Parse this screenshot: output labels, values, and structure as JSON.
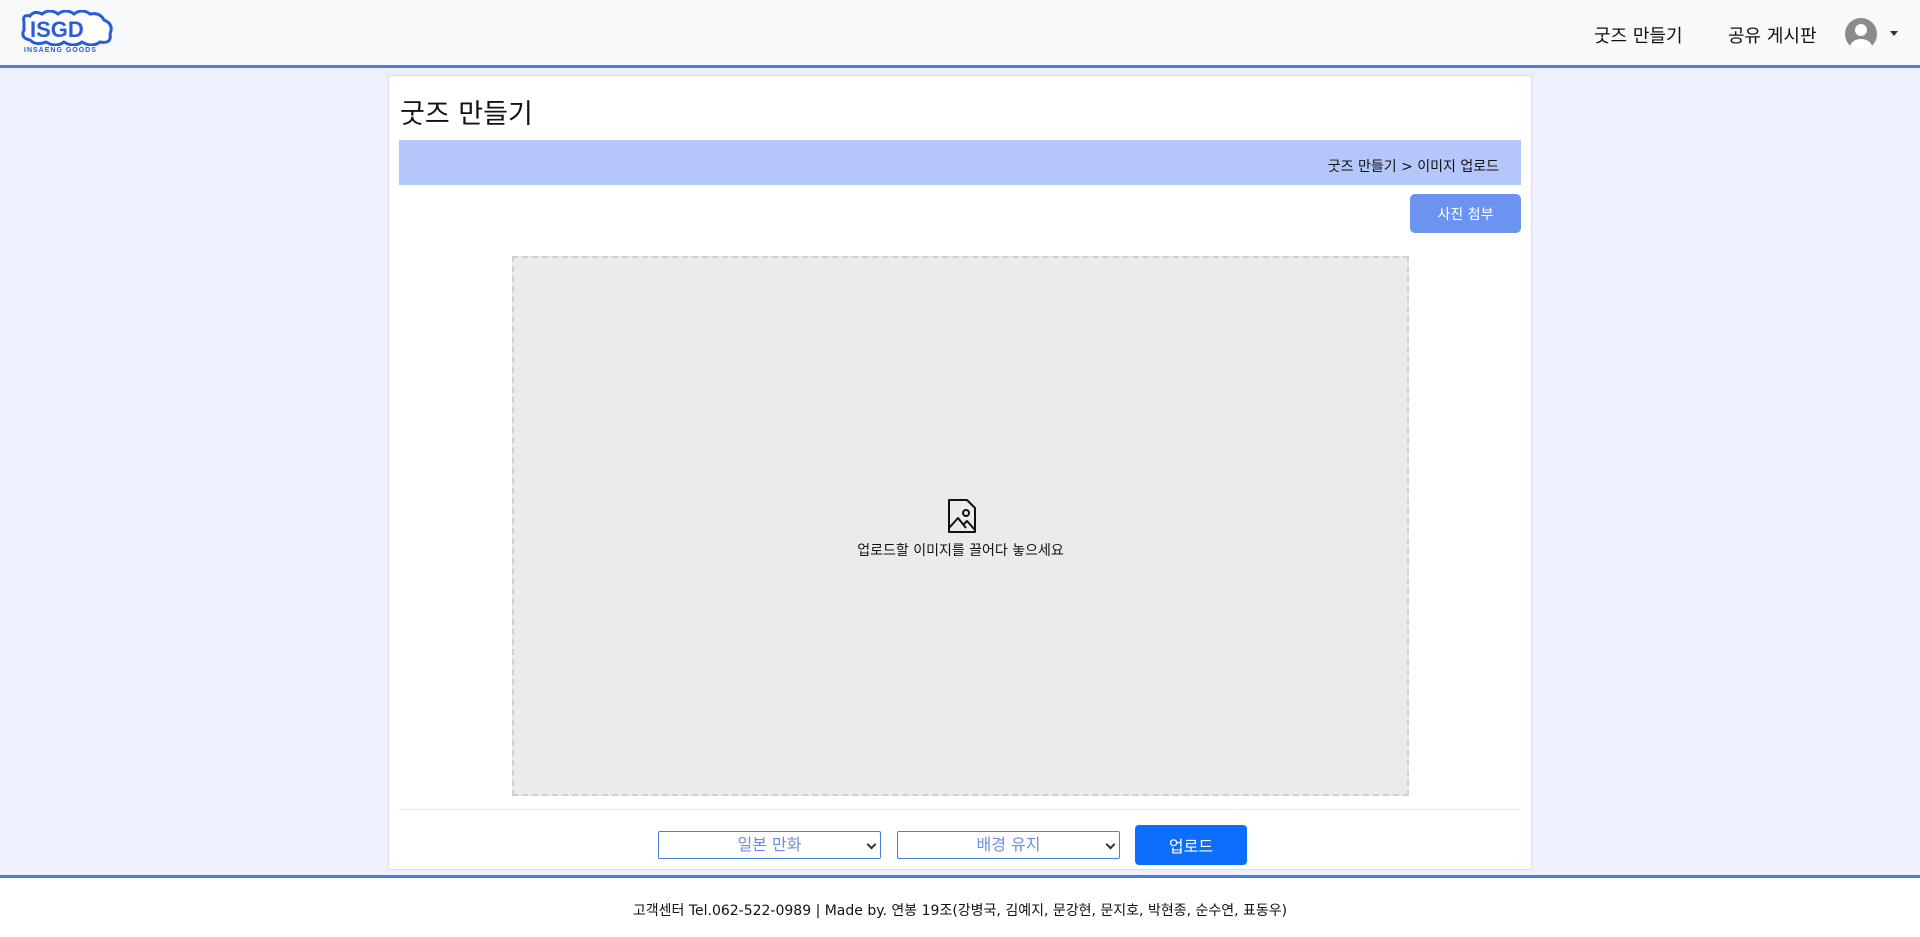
{
  "header": {
    "logo_text": "ISGD",
    "logo_subtitle": "INSAENG GOODS",
    "nav": {
      "make_goods": "굿즈 만들기",
      "share_board": "공유 게시판"
    }
  },
  "main": {
    "page_title": "굿즈 만들기",
    "breadcrumb": "굿즈 만들기 > 이미지 업로드",
    "attach_button": "사진 첨부",
    "dropzone_text": "업로드할 이미지를 끌어다 놓으세요",
    "style_select": {
      "selected": "일본 만화"
    },
    "background_select": {
      "selected": "배경 유지"
    },
    "upload_button": "업로드"
  },
  "footer": {
    "text": "고객센터 Tel.062-522-0989 | Made by. 연봉 19조(강병국, 김예지, 문강현, 문지호, 박현종, 순수연, 표동우)"
  },
  "colors": {
    "accent": "#4a7de0",
    "breadcrumb_bg": "#b3c7fb",
    "attach_button": "#6b93f2",
    "upload_button": "#0d6efd",
    "page_bg": "#eef1fd"
  },
  "icons": {
    "avatar": "user-circle-icon",
    "dropzone": "image-file-icon",
    "dropdown": "chevron-down-icon"
  }
}
